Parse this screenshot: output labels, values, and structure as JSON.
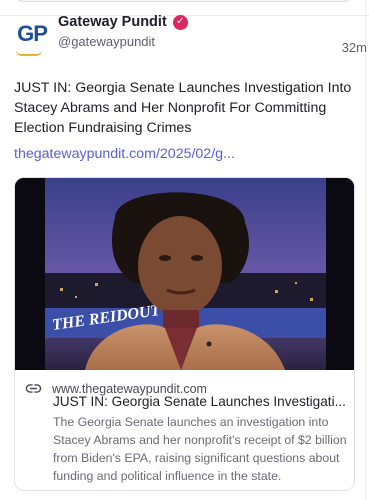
{
  "post": {
    "author_name": "Gateway Pundit",
    "handle": "@gatewaypundit",
    "timestamp": "32m",
    "avatar_initials": "GP",
    "verified_icon": "verified-badge-icon",
    "text": "JUST IN: Georgia Senate Launches Investigation Into Stacey Abrams and Her Nonprofit For Committing Election Fundraising Crimes",
    "link": "thegatewaypundit.com/2025/02/g..."
  },
  "link_card": {
    "icon": "link-icon",
    "domain": "www.thegatewaypundit.com",
    "title": "JUST IN: Georgia Senate Launches Investigati...",
    "description": "The Georgia Senate launches an investigation into Stacey Abrams and her nonprofit's receipt of $2 billion from Biden's EPA, raising significant questions about funding and political influence in the state.",
    "image_overlay_text": "THE REIDOUT"
  },
  "colors": {
    "link": "#5a5fd6",
    "verified": "#e0245e",
    "brand_blue": "#1d4f9b",
    "brand_gold": "#e8b23a"
  }
}
